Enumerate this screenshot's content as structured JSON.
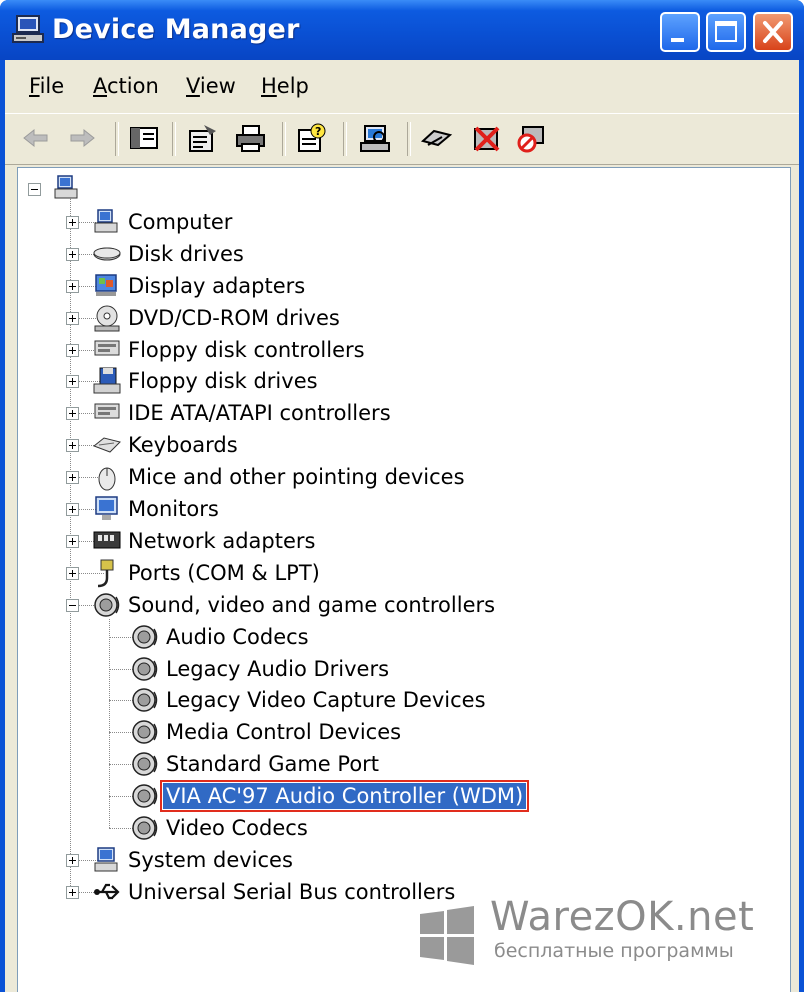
{
  "window": {
    "title": "Device Manager"
  },
  "menu": [
    {
      "label": "File",
      "u": "F",
      "rest": "ile"
    },
    {
      "label": "Action",
      "u": "A",
      "rest": "ction"
    },
    {
      "label": "View",
      "u": "V",
      "rest": "iew"
    },
    {
      "label": "Help",
      "u": "H",
      "rest": "elp"
    }
  ],
  "toolbar": [
    "back-icon",
    "forward-icon",
    "show-hide-console-tree-icon",
    "properties-icon",
    "print-icon",
    "help-icon",
    "scan-hardware-icon",
    "update-driver-icon",
    "uninstall-icon",
    "disable-icon"
  ],
  "tree": {
    "root": {
      "label": ""
    },
    "categories": [
      {
        "label": "Computer",
        "icon": "computer-icon"
      },
      {
        "label": "Disk drives",
        "icon": "disk-drive-icon"
      },
      {
        "label": "Display adapters",
        "icon": "display-adapter-icon"
      },
      {
        "label": "DVD/CD-ROM drives",
        "icon": "cdrom-icon"
      },
      {
        "label": "Floppy disk controllers",
        "icon": "controller-icon"
      },
      {
        "label": "Floppy disk drives",
        "icon": "floppy-icon"
      },
      {
        "label": "IDE ATA/ATAPI controllers",
        "icon": "controller-icon"
      },
      {
        "label": "Keyboards",
        "icon": "keyboard-icon"
      },
      {
        "label": "Mice and other pointing devices",
        "icon": "mouse-icon"
      },
      {
        "label": "Monitors",
        "icon": "monitor-icon"
      },
      {
        "label": "Network adapters",
        "icon": "network-adapter-icon"
      },
      {
        "label": "Ports (COM & LPT)",
        "icon": "port-icon"
      },
      {
        "label": "Sound, video and game controllers",
        "icon": "speaker-icon",
        "expanded": true
      }
    ],
    "sound_children": [
      {
        "label": "Audio Codecs"
      },
      {
        "label": "Legacy Audio Drivers"
      },
      {
        "label": "Legacy Video Capture Devices"
      },
      {
        "label": "Media Control Devices"
      },
      {
        "label": "Standard Game Port"
      },
      {
        "label": "VIA AC'97 Audio Controller (WDM)",
        "selected": true
      },
      {
        "label": "Video Codecs"
      }
    ],
    "after": [
      {
        "label": "System devices",
        "icon": "system-devices-icon"
      },
      {
        "label": "Universal Serial Bus controllers",
        "icon": "usb-icon"
      }
    ]
  },
  "watermark": {
    "title": "WarezOK.net",
    "subtitle": "бесплатные программы"
  }
}
